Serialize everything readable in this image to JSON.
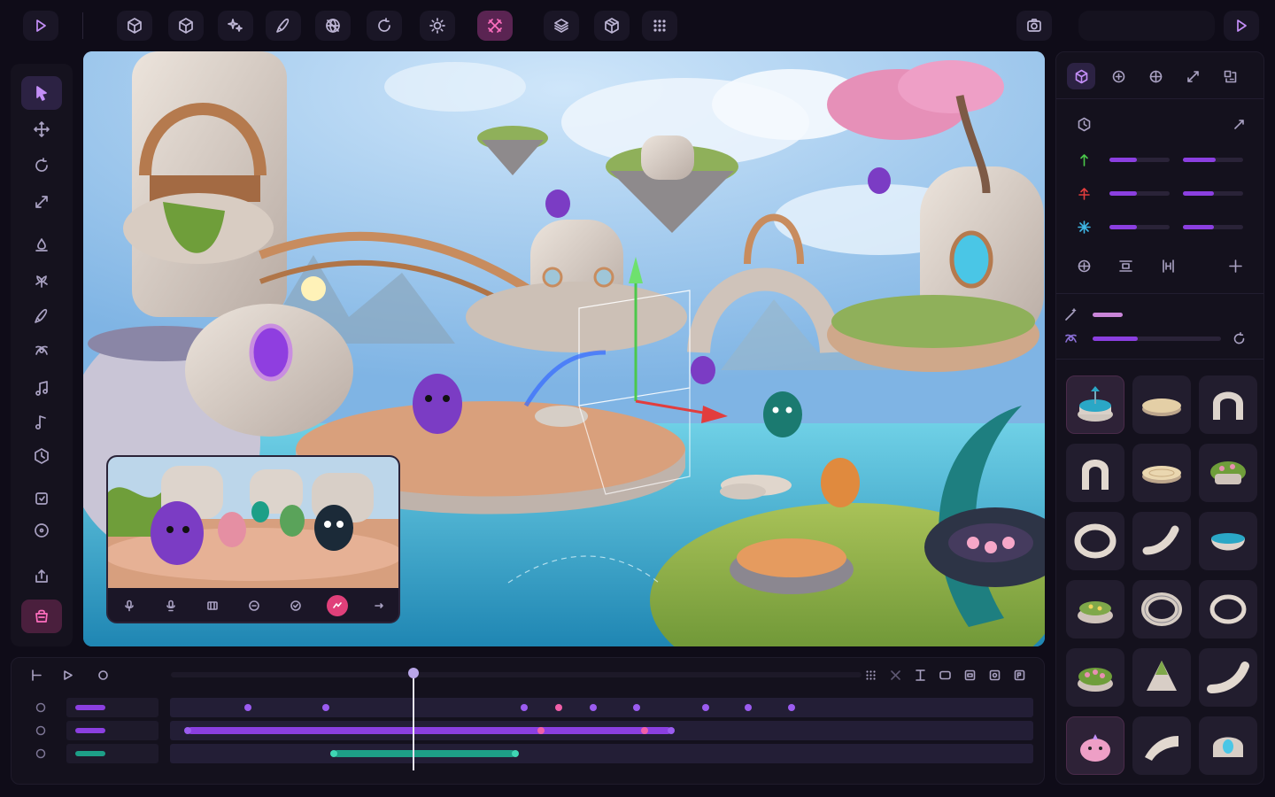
{
  "colors": {
    "accent": "#8b3fe0",
    "accent_pink": "#e0407a",
    "panel_bg": "#14111d",
    "app_bg": "#0f0c18"
  },
  "toolbar": {
    "play_icon": "play-icon",
    "tools": [
      "cube-outline-icon",
      "cube-icon",
      "sparkles-icon",
      "brush-icon",
      "grid-sphere-icon",
      "rotate-icon",
      "sun-icon",
      "crossed-tools-icon",
      "layers-icon",
      "package-icon",
      "apps-grid-icon"
    ],
    "active_tool": "crossed-tools-icon",
    "right_icons": [
      "camera-icon",
      "play-icon"
    ]
  },
  "left_tools": {
    "items": [
      "cursor-icon",
      "move-icon",
      "rotate-icon",
      "scale-icon",
      "paint-icon",
      "foliage-icon",
      "brush-icon",
      "physics-icon",
      "music-icon",
      "music-alt-icon",
      "hexagon-icon",
      "plugin-icon",
      "target-icon",
      "export-icon",
      "bag-icon"
    ],
    "selected": "cursor-icon",
    "highlighted": "bag-icon"
  },
  "right_panel": {
    "tabs": [
      "cube-icon",
      "add-circle-icon",
      "crosshair-icon",
      "measure-icon",
      "grid-transform-icon"
    ],
    "active_tab": "cube-icon",
    "transform": {
      "rows": [
        {
          "icon": "arrow-up-icon",
          "values": [
            0.45,
            0.55
          ]
        },
        {
          "icon": "rotate-axis-icon",
          "values": [
            0.45,
            0.52
          ]
        },
        {
          "icon": "scale-axis-icon",
          "values": [
            0.45,
            0.52
          ]
        }
      ]
    },
    "align_icons": [
      "align-center-icon",
      "distribute-vertical-icon",
      "distribute-horizontal-icon",
      "plus-icon"
    ],
    "extra_sliders": [
      {
        "icon": "wand-icon",
        "value": 0.2
      },
      {
        "icon": "physics-icon",
        "value": 0.35
      }
    ],
    "assets": [
      "fountain-asset",
      "platform-asset",
      "arch-asset",
      "arch-alt-asset",
      "disc-asset",
      "planter-asset",
      "ring-asset",
      "curve-asset",
      "bowl-asset",
      "garden-bed-asset",
      "ring-bevel-asset",
      "ring-thin-asset",
      "flower-bed-asset",
      "rock-cone-asset",
      "curve-long-asset",
      "creature-asset",
      "ramp-asset",
      "dome-gem-asset"
    ],
    "selected_asset": "fountain-asset"
  },
  "camera_preview": {
    "controls": [
      "mic-icon",
      "mic-alt-icon",
      "film-icon",
      "circle-icon",
      "check-icon",
      "record-icon",
      "more-icon"
    ]
  },
  "timeline": {
    "controls": [
      "go-start-icon",
      "play-icon",
      "loop-icon"
    ],
    "right_tools": [
      "grid-icon",
      "close-icon",
      "trim-icon",
      "clip-icon",
      "frame-icon",
      "snapshot-icon",
      "export-icon"
    ],
    "playhead": 0.31,
    "tracks": [
      {
        "color": "#8b3fe0",
        "keyframes": [
          0.09,
          0.18,
          0.41,
          0.45,
          0.49,
          0.54,
          0.62,
          0.67,
          0.72
        ],
        "segments": []
      },
      {
        "color": "#8b3fe0",
        "keyframes": [
          0.02,
          0.43,
          0.55,
          0.58
        ],
        "segments": [
          [
            0.02,
            0.58
          ]
        ]
      },
      {
        "color": "#1d9f87",
        "keyframes": [
          0.19,
          0.4
        ],
        "segments": [
          [
            0.19,
            0.4
          ]
        ]
      }
    ]
  }
}
